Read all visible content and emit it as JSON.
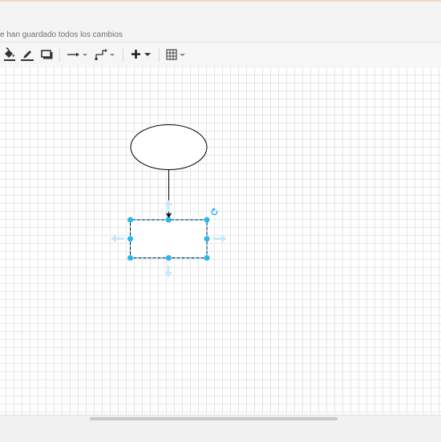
{
  "header": {
    "save_status": "e han guardado todos los cambios"
  },
  "toolbar": {
    "items": [
      {
        "name": "fill-color-button",
        "icon": "paint-bucket-icon"
      },
      {
        "name": "line-color-button",
        "icon": "pencil-line-icon"
      },
      {
        "name": "shadow-button",
        "icon": "shadow-box-icon"
      },
      {
        "name": "connection-style-button",
        "icon": "arrow-right-dropdown-icon"
      },
      {
        "name": "waypoints-button",
        "icon": "elbow-connector-dropdown-icon"
      },
      {
        "name": "insert-button",
        "icon": "plus-dropdown-icon"
      },
      {
        "name": "table-button",
        "icon": "table-dropdown-icon"
      }
    ]
  },
  "diagram": {
    "shapes": [
      {
        "type": "ellipse",
        "label": "",
        "selected": false
      },
      {
        "type": "rectangle",
        "label": "",
        "selected": true
      }
    ],
    "edge": {
      "from": "ellipse",
      "to": "rectangle",
      "arrow": "classic"
    }
  },
  "colors": {
    "selection_handle": "#29b6f2",
    "hover_arrow": "#c9e8f9",
    "grid": "#e6e6e6",
    "shape_stroke": "#000000"
  }
}
